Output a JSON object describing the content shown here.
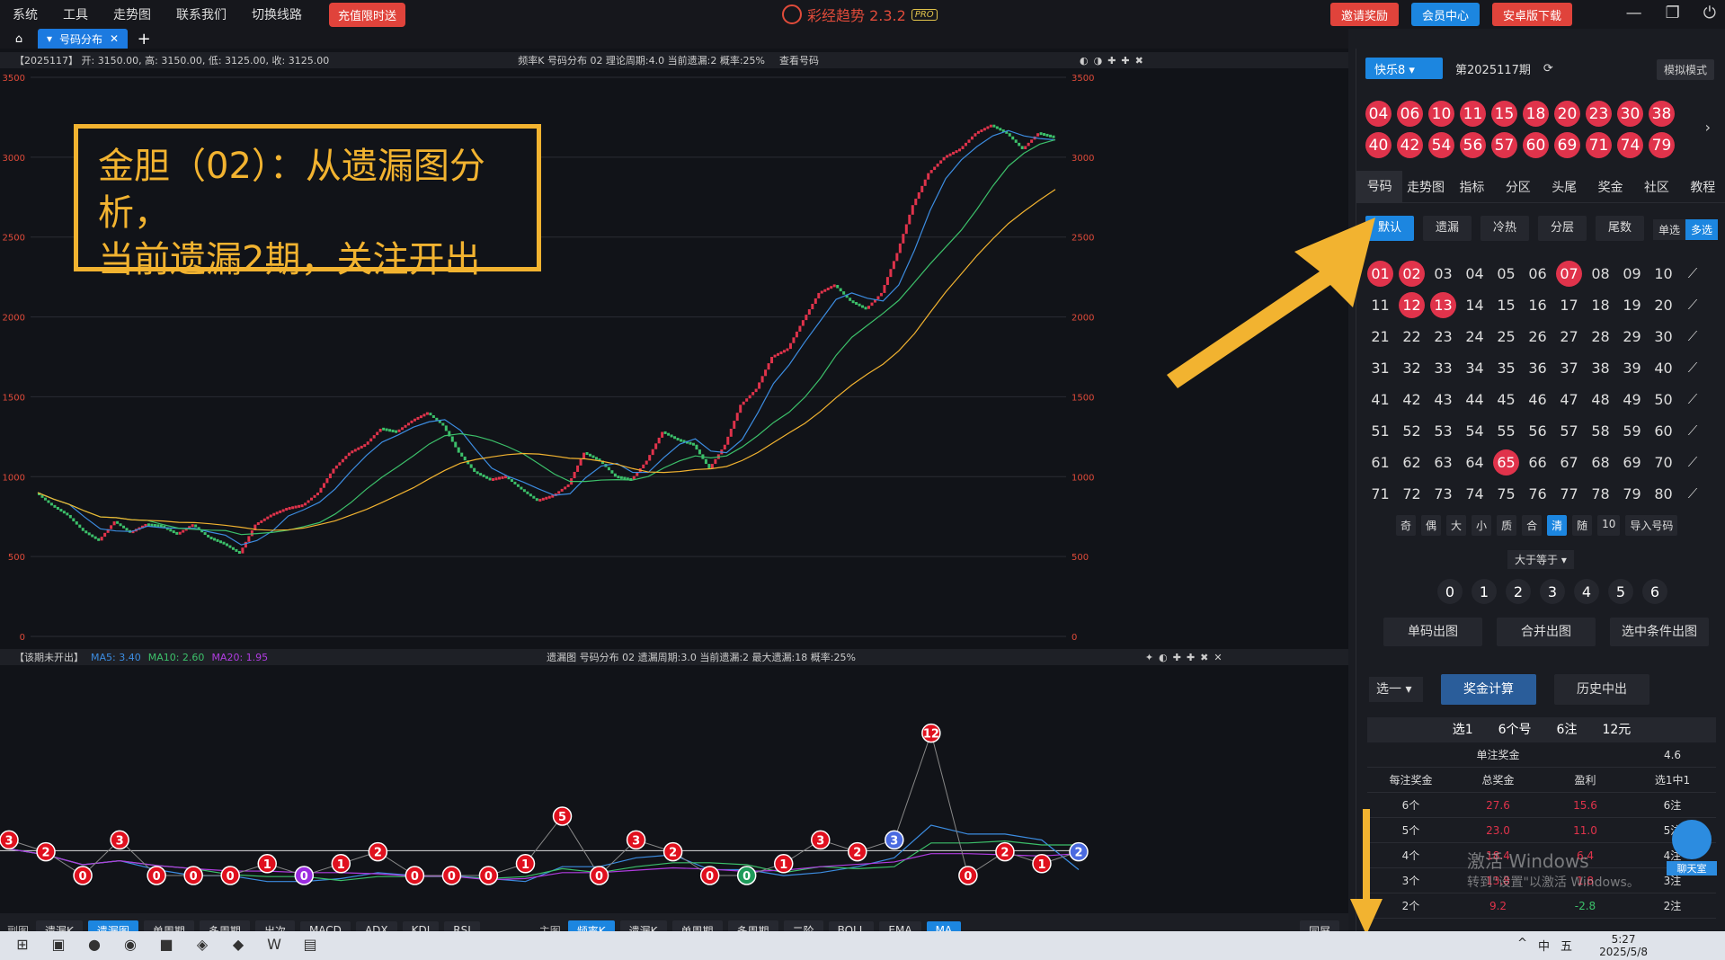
{
  "menu": [
    "系统",
    "工具",
    "走势图",
    "联系我们",
    "切换线路"
  ],
  "promo": "充值限时送",
  "app_title": "彩经趋势 2.3.2",
  "app_badge": "PRO",
  "top_buttons": [
    {
      "label": "邀请奖励",
      "color": "#e0433b"
    },
    {
      "label": "会员中心",
      "color": "#1c86e0"
    },
    {
      "label": "安卓版下载",
      "color": "#e0433b"
    }
  ],
  "tab": {
    "label": "号码分布"
  },
  "chart1_info": {
    "left": "【2025117】 开: 3150.00, 高: 3150.00, 低: 3125.00, 收: 3125.00",
    "center": "频率K  号码分布 02  理论周期:4.0  当前遗漏:2  概率:25%",
    "link": "查看号码"
  },
  "chart2_info": {
    "left": "【该期未开出】",
    "ma5": "MA5: 3.40",
    "ma10": "MA10: 2.60",
    "ma20": "MA20: 1.95",
    "center": "遗漏图  号码分布 02  遗漏周期:3.0  当前遗漏:2  最大遗漏:18  概率:25%"
  },
  "callout": {
    "line1": "金胆（02）：从遗漏图分析，",
    "line2": "当前遗漏2期，关注开出"
  },
  "chart_data": [
    {
      "type": "line",
      "title": "频率K",
      "ylim": [
        0,
        3500
      ],
      "yticks": [
        0,
        500,
        1000,
        1500,
        2000,
        2500,
        3000,
        3500
      ],
      "series": [
        {
          "name": "K",
          "values": [
            900,
            820,
            760,
            660,
            600,
            720,
            650,
            700,
            690,
            640,
            700,
            620,
            580,
            520,
            700,
            760,
            800,
            820,
            900,
            1050,
            1150,
            1200,
            1300,
            1280,
            1350,
            1400,
            1320,
            1150,
            1030,
            980,
            1000,
            920,
            850,
            880,
            950,
            1150,
            1100,
            1000,
            980,
            1100,
            1280,
            1230,
            1200,
            1050,
            1200,
            1450,
            1550,
            1750,
            1800,
            1980,
            2150,
            2200,
            2100,
            2050,
            2150,
            2400,
            2700,
            2900,
            3000,
            3050,
            3150,
            3200,
            3150,
            3050,
            3150,
            3125
          ]
        }
      ]
    },
    {
      "type": "scatter",
      "title": "遗漏图",
      "values": [
        3,
        2,
        0,
        3,
        0,
        0,
        0,
        1,
        0,
        1,
        2,
        0,
        0,
        0,
        1,
        5,
        0,
        3,
        2,
        0,
        0,
        1,
        3,
        2,
        3,
        12,
        0,
        2,
        1,
        2
      ]
    }
  ],
  "right": {
    "lottery": "快乐8",
    "period": "第2025117期",
    "mock": "模拟模式",
    "drawn": [
      "04",
      "06",
      "10",
      "11",
      "15",
      "18",
      "20",
      "23",
      "30",
      "38",
      "40",
      "42",
      "54",
      "56",
      "57",
      "60",
      "69",
      "71",
      "74",
      "79"
    ],
    "nav": [
      "号码",
      "走势图",
      "指标",
      "分区",
      "头尾",
      "奖金",
      "社区",
      "教程"
    ],
    "subtabs": [
      "默认",
      "遗漏",
      "冷热",
      "分层",
      "尾数"
    ],
    "selmode": [
      "单选",
      "多选"
    ],
    "grid": [
      [
        "01",
        "02",
        "03",
        "04",
        "05",
        "06",
        "07",
        "08",
        "09",
        "10"
      ],
      [
        "11",
        "12",
        "13",
        "14",
        "15",
        "16",
        "17",
        "18",
        "19",
        "20"
      ],
      [
        "21",
        "22",
        "23",
        "24",
        "25",
        "26",
        "27",
        "28",
        "29",
        "30"
      ],
      [
        "31",
        "32",
        "33",
        "34",
        "35",
        "36",
        "37",
        "38",
        "39",
        "40"
      ],
      [
        "41",
        "42",
        "43",
        "44",
        "45",
        "46",
        "47",
        "48",
        "49",
        "50"
      ],
      [
        "51",
        "52",
        "53",
        "54",
        "55",
        "56",
        "57",
        "58",
        "59",
        "60"
      ],
      [
        "61",
        "62",
        "63",
        "64",
        "65",
        "66",
        "67",
        "68",
        "69",
        "70"
      ],
      [
        "71",
        "72",
        "73",
        "74",
        "75",
        "76",
        "77",
        "78",
        "79",
        "80"
      ]
    ],
    "selected": [
      "01",
      "02",
      "07",
      "12",
      "13",
      "65"
    ],
    "filters": [
      "奇",
      "偶",
      "大",
      "小",
      "质",
      "合",
      "清",
      "随",
      "10",
      "导入号码"
    ],
    "cond": "大于等于",
    "counts": [
      "0",
      "1",
      "2",
      "3",
      "4",
      "5",
      "6"
    ],
    "out_buttons": [
      "单码出图",
      "合并出图",
      "选中条件出图"
    ],
    "select": "选一",
    "calc": "奖金计算",
    "history": "历史中出",
    "prize_head": [
      "选1",
      "6个号",
      "6注",
      "12元"
    ],
    "single_prize": [
      "单注奖金",
      "4.6"
    ],
    "cols": [
      "每注奖金",
      "总奖金",
      "盈利",
      "选1中1"
    ],
    "rows": [
      [
        "6个",
        "27.6",
        "15.6",
        "6注"
      ],
      [
        "5个",
        "23.0",
        "11.0",
        "5注"
      ],
      [
        "4个",
        "18.4",
        "6.4",
        "4注"
      ],
      [
        "3个",
        "13.8",
        "1.8",
        "3注"
      ],
      [
        "2个",
        "9.2",
        "-2.8",
        "2注"
      ]
    ]
  },
  "bottom_left": {
    "label": "副图",
    "items": [
      "遗漏K",
      "遗漏图",
      "单周期",
      "多周期",
      "出次",
      "MACD",
      "ADX",
      "KDJ",
      "RSI"
    ],
    "active": "遗漏图"
  },
  "bottom_right": {
    "label": "主图",
    "items": [
      "频率K",
      "遗漏K",
      "单周期",
      "多周期",
      "二阶",
      "BOLL",
      "EMA",
      "MA"
    ],
    "active_a": "频率K",
    "active_b": "MA"
  },
  "fullscreen": "同屏",
  "watermark": {
    "l1": "激活 Windows",
    "l2": "转到\"设置\"以激活 Windows。"
  },
  "chat": "聊天室",
  "clock": {
    "time": "5:27",
    "date": "2025/5/8"
  },
  "tray": [
    "中",
    "五"
  ]
}
